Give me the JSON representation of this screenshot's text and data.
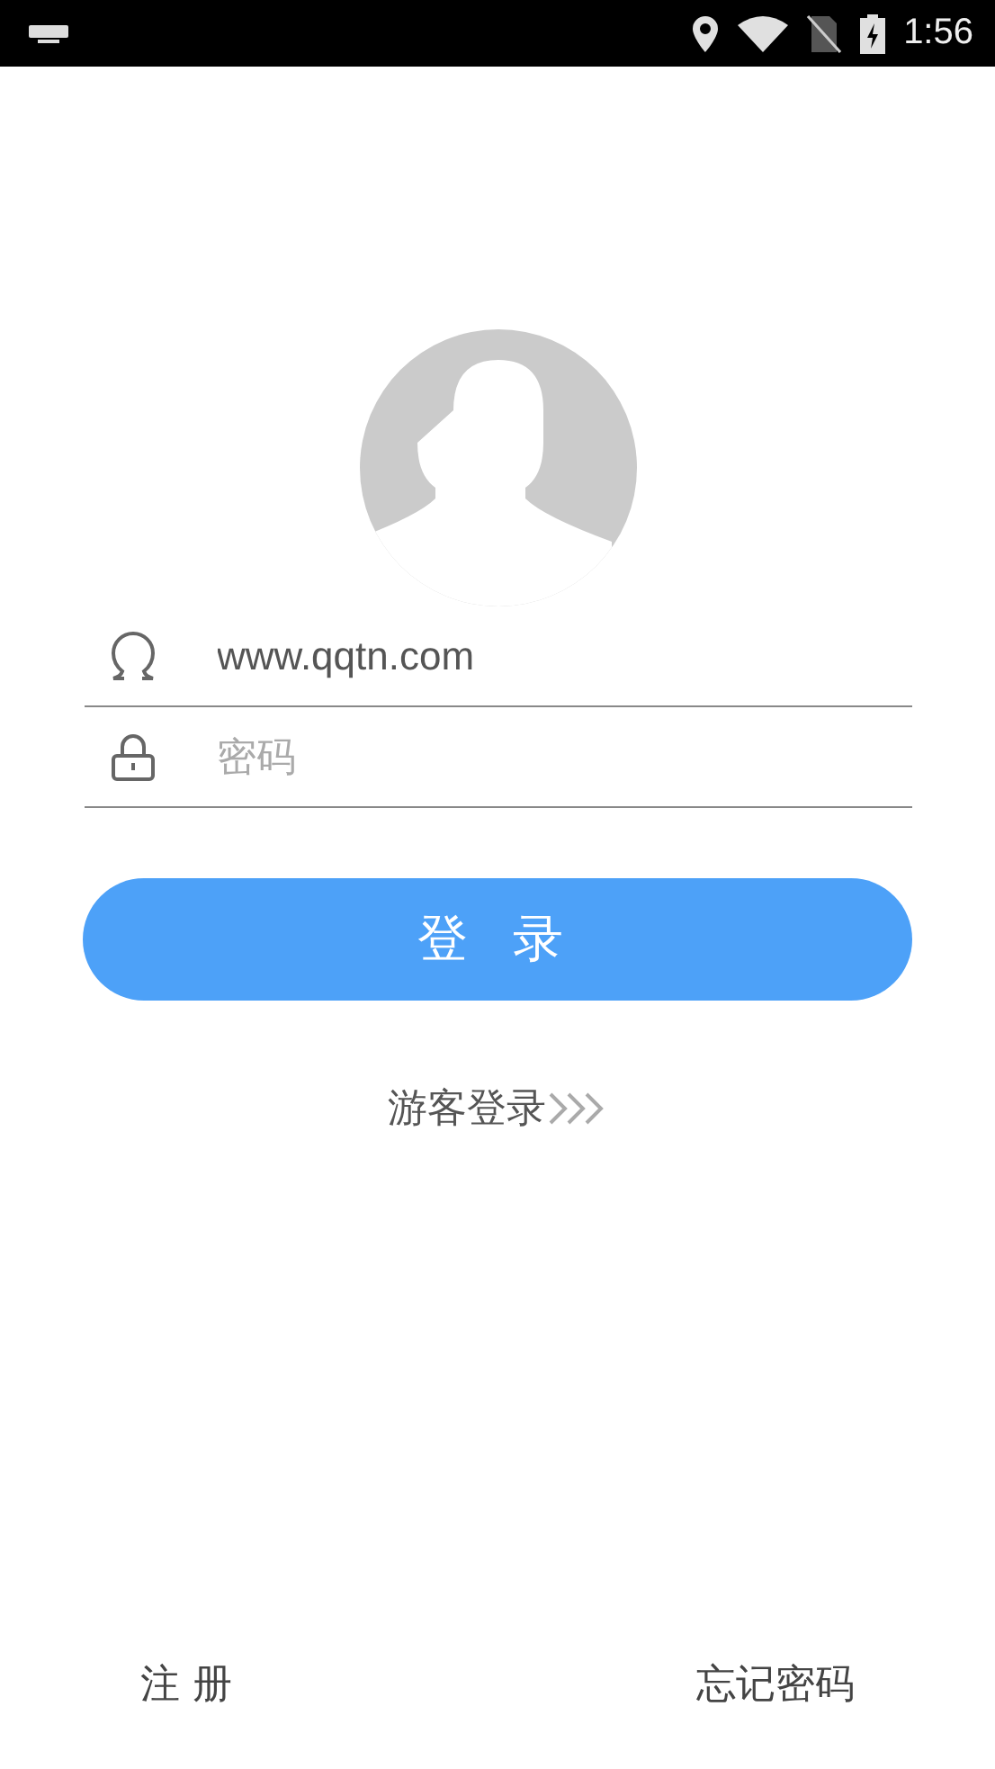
{
  "status_bar": {
    "time": "1:56"
  },
  "username": {
    "value": "www.qqtn.com"
  },
  "password": {
    "placeholder": "密码"
  },
  "login_button": {
    "label": "登 录"
  },
  "guest_login": {
    "label": "游客登录"
  },
  "footer": {
    "register": "注 册",
    "forgot_password": "忘记密码"
  }
}
